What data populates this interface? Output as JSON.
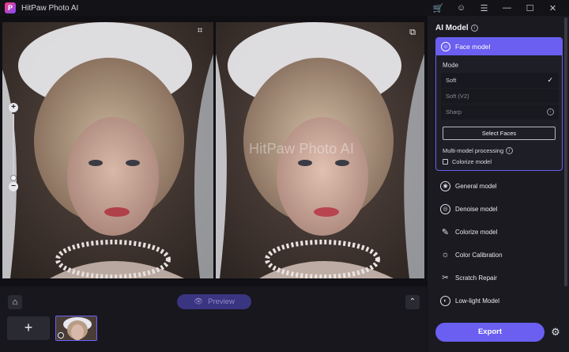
{
  "titlebar": {
    "logo_letter": "P",
    "title": "HitPaw Photo AI",
    "icons": [
      "cart-icon",
      "user-icon",
      "menu-icon",
      "minimize-icon",
      "maximize-icon",
      "close-icon"
    ]
  },
  "preview": {
    "watermark": "HitPaw Photo AI",
    "zoom_in": "+",
    "zoom_out": "−"
  },
  "bottom": {
    "preview_label": "Preview",
    "add_label": "+"
  },
  "panel": {
    "title": "AI Model",
    "face_model": {
      "label": "Face model",
      "mode_label": "Mode",
      "modes": [
        {
          "label": "Soft",
          "selected": true
        },
        {
          "label": "Soft (V2)",
          "selected": false
        },
        {
          "label": "Sharp",
          "selected": false
        }
      ],
      "select_faces": "Select Faces",
      "multi_model": "Multi-model processing",
      "colorize_model": "Colorize model"
    },
    "models": [
      {
        "label": "General model",
        "icon": "general-model-icon"
      },
      {
        "label": "Denoise model",
        "icon": "denoise-model-icon"
      },
      {
        "label": "Colorize model",
        "icon": "colorize-model-icon"
      },
      {
        "label": "Color Calibration",
        "icon": "color-calibration-icon"
      },
      {
        "label": "Scratch Repair",
        "icon": "scratch-repair-icon"
      },
      {
        "label": "Low-light Model",
        "icon": "low-light-model-icon"
      }
    ],
    "export_label": "Export"
  },
  "colors": {
    "accent": "#6a5ff0",
    "background": "#0f0f14",
    "panel": "#1a1a20"
  }
}
